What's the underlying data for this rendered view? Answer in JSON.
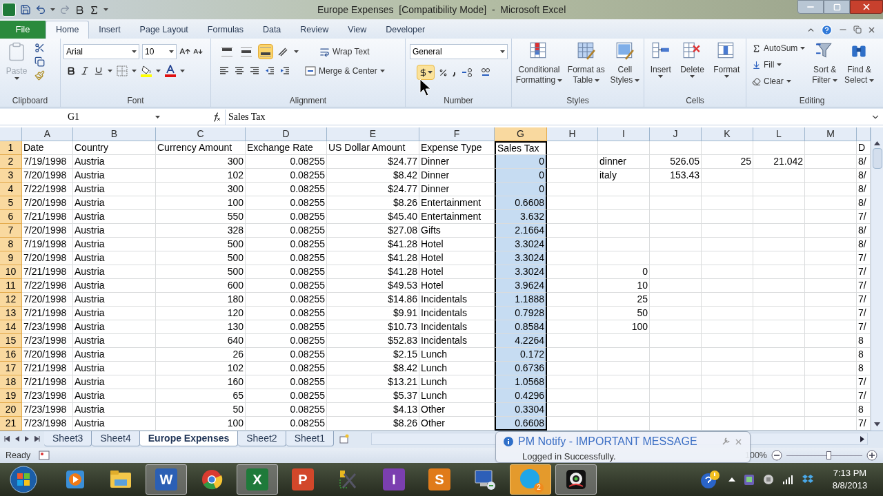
{
  "window": {
    "title": "Europe Expenses  [Compatibility Mode]  -  Microsoft Excel"
  },
  "ribbon": {
    "tabs": [
      {
        "label": "File",
        "kind": "file",
        "selected": false
      },
      {
        "label": "Home",
        "kind": "tab",
        "selected": true
      },
      {
        "label": "Insert",
        "kind": "tab",
        "selected": false
      },
      {
        "label": "Page Layout",
        "kind": "tab",
        "selected": false
      },
      {
        "label": "Formulas",
        "kind": "tab",
        "selected": false
      },
      {
        "label": "Data",
        "kind": "tab",
        "selected": false
      },
      {
        "label": "Review",
        "kind": "tab",
        "selected": false
      },
      {
        "label": "View",
        "kind": "tab",
        "selected": false
      },
      {
        "label": "Developer",
        "kind": "tab",
        "selected": false
      }
    ],
    "clipboard": {
      "label": "Clipboard",
      "paste": "Paste"
    },
    "font": {
      "label": "Font",
      "family": "Arial",
      "size": "10"
    },
    "alignment": {
      "label": "Alignment",
      "vertical": [
        {
          "kind": "top",
          "selected": false
        },
        {
          "kind": "middle",
          "selected": false
        },
        {
          "kind": "bottom",
          "selected": true
        }
      ],
      "wrap": "Wrap Text",
      "merge": "Merge & Center"
    },
    "number": {
      "label": "Number",
      "format": "General",
      "currency_highlighted": true
    },
    "styles": {
      "label": "Styles",
      "buttons": [
        {
          "kind": "conditional",
          "lines": [
            "Conditional",
            "Formatting"
          ]
        },
        {
          "kind": "table",
          "lines": [
            "Format as",
            "Table"
          ]
        },
        {
          "kind": "cell-styles",
          "lines": [
            "Cell",
            "Styles"
          ]
        }
      ]
    },
    "cells": {
      "label": "Cells",
      "buttons": [
        {
          "kind": "insert",
          "label": "Insert"
        },
        {
          "kind": "delete",
          "label": "Delete"
        },
        {
          "kind": "format",
          "label": "Format"
        }
      ]
    },
    "editing": {
      "label": "Editing",
      "items": [
        {
          "kind": "autosum",
          "label": "AutoSum"
        },
        {
          "kind": "fill",
          "label": "Fill"
        },
        {
          "kind": "clear",
          "label": "Clear"
        }
      ],
      "buttons": [
        {
          "kind": "sort",
          "lines": [
            "Sort &",
            "Filter"
          ]
        },
        {
          "kind": "find",
          "lines": [
            "Find &",
            "Select"
          ]
        }
      ]
    }
  },
  "formula_bar": {
    "name_box": "G1",
    "formula": "Sales Tax"
  },
  "sheet": {
    "columns": [
      {
        "label": "A",
        "kind": "text",
        "selected": false
      },
      {
        "label": "B",
        "kind": "text",
        "selected": false
      },
      {
        "label": "C",
        "kind": "number",
        "selected": false
      },
      {
        "label": "D",
        "kind": "number",
        "selected": false
      },
      {
        "label": "E",
        "kind": "number",
        "selected": false
      },
      {
        "label": "F",
        "kind": "text",
        "selected": false
      },
      {
        "label": "G",
        "kind": "number",
        "selected": true
      },
      {
        "label": "H",
        "selected": false
      },
      {
        "label": "I",
        "kind": "number",
        "selected": false
      },
      {
        "label": "J",
        "kind": "number",
        "selected": false
      },
      {
        "label": "K",
        "kind": "number",
        "selected": false
      },
      {
        "label": "L",
        "kind": "number",
        "selected": false
      },
      {
        "label": "M",
        "selected": false
      },
      {
        "kind": "text",
        "selected": false
      }
    ],
    "rows": [
      {
        "number": "1",
        "cells": [
          "Date",
          "Country",
          {
            "value": "Currency Amount",
            "kind": "text"
          },
          {
            "value": "Exchange Rate",
            "kind": "text"
          },
          {
            "value": "US Dollar Amount",
            "kind": "text"
          },
          "Expense Type",
          {
            "value": "Sales Tax",
            "kind": "text"
          },
          null,
          null,
          null,
          null,
          null,
          null,
          "D"
        ]
      },
      {
        "number": "2",
        "cells": [
          "7/19/1998",
          "Austria",
          "300",
          "0.08255",
          "$24.77",
          "Dinner",
          "0",
          null,
          {
            "value": "dinner",
            "kind": "text"
          },
          "526.05",
          "25",
          "21.042",
          null,
          "8/"
        ]
      },
      {
        "number": "3",
        "cells": [
          "7/20/1998",
          "Austria",
          "102",
          "0.08255",
          "$8.42",
          "Dinner",
          "0",
          null,
          {
            "value": "italy",
            "kind": "text"
          },
          "153.43",
          null,
          null,
          null,
          "8/"
        ]
      },
      {
        "number": "4",
        "cells": [
          "7/22/1998",
          "Austria",
          "300",
          "0.08255",
          "$24.77",
          "Dinner",
          "0",
          null,
          null,
          null,
          null,
          null,
          null,
          "8/"
        ]
      },
      {
        "number": "5",
        "cells": [
          "7/20/1998",
          "Austria",
          "100",
          "0.08255",
          "$8.26",
          "Entertainment",
          "0.6608",
          null,
          null,
          null,
          null,
          null,
          null,
          "8/"
        ]
      },
      {
        "number": "6",
        "cells": [
          "7/21/1998",
          "Austria",
          "550",
          "0.08255",
          "$45.40",
          "Entertainment",
          "3.632",
          null,
          null,
          null,
          null,
          null,
          null,
          "7/"
        ]
      },
      {
        "number": "7",
        "cells": [
          "7/20/1998",
          "Austria",
          "328",
          "0.08255",
          "$27.08",
          "Gifts",
          "2.1664",
          null,
          null,
          null,
          null,
          null,
          null,
          "8/"
        ]
      },
      {
        "number": "8",
        "cells": [
          "7/19/1998",
          "Austria",
          "500",
          "0.08255",
          "$41.28",
          "Hotel",
          "3.3024",
          null,
          null,
          null,
          null,
          null,
          null,
          "8/"
        ]
      },
      {
        "number": "9",
        "cells": [
          "7/20/1998",
          "Austria",
          "500",
          "0.08255",
          "$41.28",
          "Hotel",
          "3.3024",
          null,
          null,
          null,
          null,
          null,
          null,
          "7/"
        ]
      },
      {
        "number": "10",
        "cells": [
          "7/21/1998",
          "Austria",
          "500",
          "0.08255",
          "$41.28",
          "Hotel",
          "3.3024",
          null,
          "0",
          null,
          null,
          null,
          null,
          "7/"
        ]
      },
      {
        "number": "11",
        "cells": [
          "7/22/1998",
          "Austria",
          "600",
          "0.08255",
          "$49.53",
          "Hotel",
          "3.9624",
          null,
          "10",
          null,
          null,
          null,
          null,
          "7/"
        ]
      },
      {
        "number": "12",
        "cells": [
          "7/20/1998",
          "Austria",
          "180",
          "0.08255",
          "$14.86",
          "Incidentals",
          "1.1888",
          null,
          "25",
          null,
          null,
          null,
          null,
          "7/"
        ]
      },
      {
        "number": "13",
        "cells": [
          "7/21/1998",
          "Austria",
          "120",
          "0.08255",
          "$9.91",
          "Incidentals",
          "0.7928",
          null,
          "50",
          null,
          null,
          null,
          null,
          "7/"
        ]
      },
      {
        "number": "14",
        "cells": [
          "7/23/1998",
          "Austria",
          "130",
          "0.08255",
          "$10.73",
          "Incidentals",
          "0.8584",
          null,
          "100",
          null,
          null,
          null,
          null,
          "7/"
        ]
      },
      {
        "number": "15",
        "cells": [
          "7/23/1998",
          "Austria",
          "640",
          "0.08255",
          "$52.83",
          "Incidentals",
          "4.2264",
          null,
          null,
          null,
          null,
          null,
          null,
          "8"
        ]
      },
      {
        "number": "16",
        "cells": [
          "7/20/1998",
          "Austria",
          "26",
          "0.08255",
          "$2.15",
          "Lunch",
          "0.172",
          null,
          null,
          null,
          null,
          null,
          null,
          "8"
        ]
      },
      {
        "number": "17",
        "cells": [
          "7/21/1998",
          "Austria",
          "102",
          "0.08255",
          "$8.42",
          "Lunch",
          "0.6736",
          null,
          null,
          null,
          null,
          null,
          null,
          "8"
        ]
      },
      {
        "number": "18",
        "cells": [
          "7/21/1998",
          "Austria",
          "160",
          "0.08255",
          "$13.21",
          "Lunch",
          "1.0568",
          null,
          null,
          null,
          null,
          null,
          null,
          "7/"
        ]
      },
      {
        "number": "19",
        "cells": [
          "7/23/1998",
          "Austria",
          "65",
          "0.08255",
          "$5.37",
          "Lunch",
          "0.4296",
          null,
          null,
          null,
          null,
          null,
          null,
          "7/"
        ]
      },
      {
        "number": "20",
        "cells": [
          "7/23/1998",
          "Austria",
          "50",
          "0.08255",
          "$4.13",
          "Other",
          "0.3304",
          null,
          null,
          null,
          null,
          null,
          null,
          "8"
        ]
      },
      {
        "number": "21",
        "cells": [
          "7/23/1998",
          "Austria",
          "100",
          "0.08255",
          "$8.26",
          "Other",
          "0.6608",
          null,
          null,
          null,
          null,
          null,
          null,
          "7/"
        ]
      }
    ],
    "tabs": [
      {
        "label": "Sheet3",
        "selected": false
      },
      {
        "label": "Sheet4",
        "selected": false
      },
      {
        "label": "Europe Expenses",
        "selected": true
      },
      {
        "label": "Sheet2",
        "selected": false
      },
      {
        "label": "Sheet1",
        "selected": false
      }
    ]
  },
  "status_bar": {
    "mode": "Ready",
    "zoom": "100%",
    "zoom_slider": {
      "level": 0.55
    }
  },
  "notification": {
    "title": "PM Notify - IMPORTANT MESSAGE",
    "message": "Logged in Successfully."
  },
  "taskbar": {
    "apps": [
      {
        "kind": "media",
        "running": false
      },
      {
        "kind": "folder",
        "running": false
      },
      {
        "kind": "tile",
        "letter": "W",
        "color": "#2b5fb4",
        "running": true
      },
      {
        "kind": "chrome",
        "running": false
      },
      {
        "kind": "tile",
        "letter": "X",
        "color": "#1f7a3a",
        "running": true
      },
      {
        "kind": "tile",
        "letter": "P",
        "color": "#d2472a",
        "running": false
      },
      {
        "kind": "tools",
        "running": false
      },
      {
        "kind": "tile",
        "letter": "I",
        "color": "#7b3fb0",
        "running": false
      },
      {
        "kind": "tile",
        "letter": "S",
        "color": "#e07b1a",
        "running": false
      },
      {
        "kind": "remote",
        "running": false
      },
      {
        "kind": "skype",
        "badge": "2",
        "running": true
      },
      {
        "kind": "camera",
        "running": true
      }
    ],
    "time": "7:13 PM",
    "date": "8/8/2013"
  }
}
